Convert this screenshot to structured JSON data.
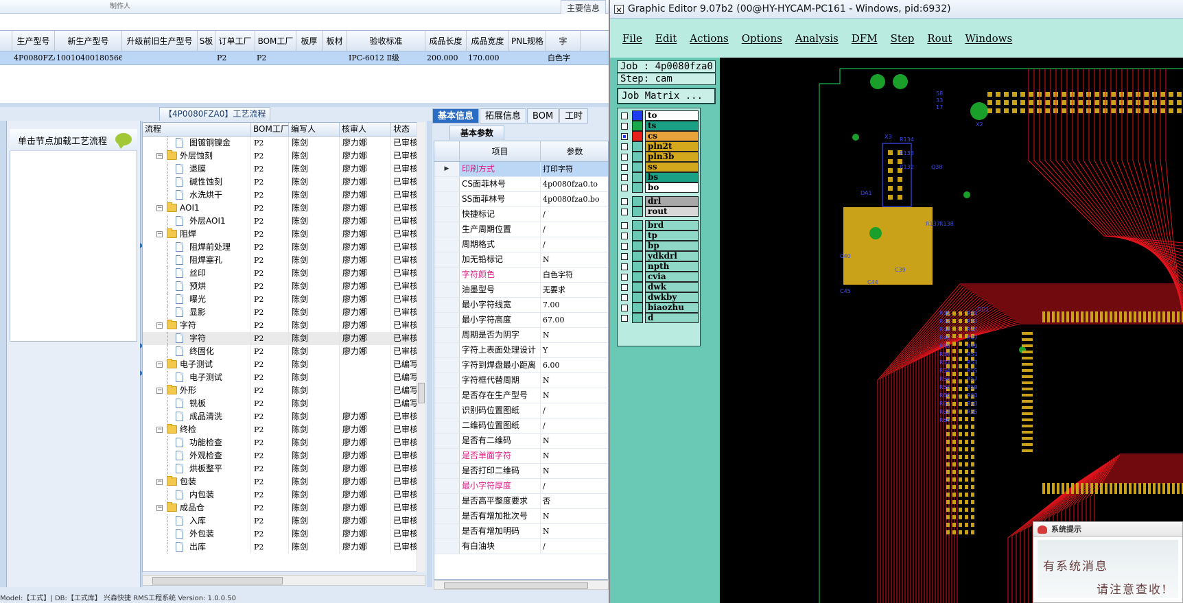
{
  "top": {
    "stub": "制作人",
    "main_info_tab": "主要信息"
  },
  "grid1": {
    "headers": [
      "",
      "生产型号",
      "新生产型号",
      "升级前旧生产型号",
      "S板",
      "订单工厂",
      "BOM工厂",
      "板厚",
      "板材",
      "验收标准",
      "成品长度",
      "成品宽度",
      "PNL规格",
      "字"
    ],
    "row": [
      "",
      "4P0080FZA0",
      "10010400180566",
      "",
      "",
      "P2",
      "P2",
      "",
      "",
      "IPC-6012 Ⅱ级",
      "200.000",
      "170.000",
      "",
      "白色字"
    ]
  },
  "process_title": "【4P0080FZA0】工艺流程",
  "node_hint": "单击节点加载工艺流程",
  "tree": {
    "headers": [
      "流程",
      "BOM工厂",
      "编写人",
      "核审人",
      "状态"
    ],
    "rows": [
      {
        "label": "图镀铜镍金",
        "level": 2,
        "kind": "doc",
        "bom": "P2",
        "writer": "陈剑",
        "reviewer": "廖力娜",
        "status": "已审核"
      },
      {
        "label": "外层蚀刻",
        "level": 1,
        "kind": "folder",
        "bom": "P2",
        "writer": "陈剑",
        "reviewer": "廖力娜",
        "status": "已审核"
      },
      {
        "label": "退膜",
        "level": 2,
        "kind": "doc",
        "bom": "P2",
        "writer": "陈剑",
        "reviewer": "廖力娜",
        "status": "已审核"
      },
      {
        "label": "碱性蚀刻",
        "level": 2,
        "kind": "doc",
        "bom": "P2",
        "writer": "陈剑",
        "reviewer": "廖力娜",
        "status": "已审核"
      },
      {
        "label": "水洗烘干",
        "level": 2,
        "kind": "doc",
        "bom": "P2",
        "writer": "陈剑",
        "reviewer": "廖力娜",
        "status": "已审核"
      },
      {
        "label": "AOI1",
        "level": 1,
        "kind": "folder",
        "bom": "P2",
        "writer": "陈剑",
        "reviewer": "廖力娜",
        "status": "已审核"
      },
      {
        "label": "外层AOI1",
        "level": 2,
        "kind": "doc",
        "bom": "P2",
        "writer": "陈剑",
        "reviewer": "廖力娜",
        "status": "已审核"
      },
      {
        "label": "阻焊",
        "level": 1,
        "kind": "folder",
        "bom": "P2",
        "writer": "陈剑",
        "reviewer": "廖力娜",
        "status": "已审核"
      },
      {
        "label": "阻焊前处理",
        "level": 2,
        "kind": "doc",
        "bom": "P2",
        "writer": "陈剑",
        "reviewer": "廖力娜",
        "status": "已审核"
      },
      {
        "label": "阻焊塞孔",
        "level": 2,
        "kind": "doc",
        "bom": "P2",
        "writer": "陈剑",
        "reviewer": "廖力娜",
        "status": "已审核"
      },
      {
        "label": "丝印",
        "level": 2,
        "kind": "doc",
        "bom": "P2",
        "writer": "陈剑",
        "reviewer": "廖力娜",
        "status": "已审核"
      },
      {
        "label": "预烘",
        "level": 2,
        "kind": "doc",
        "bom": "P2",
        "writer": "陈剑",
        "reviewer": "廖力娜",
        "status": "已审核"
      },
      {
        "label": "曝光",
        "level": 2,
        "kind": "doc",
        "bom": "P2",
        "writer": "陈剑",
        "reviewer": "廖力娜",
        "status": "已审核"
      },
      {
        "label": "显影",
        "level": 2,
        "kind": "doc",
        "bom": "P2",
        "writer": "陈剑",
        "reviewer": "廖力娜",
        "status": "已审核"
      },
      {
        "label": "字符",
        "level": 1,
        "kind": "folder",
        "bom": "P2",
        "writer": "陈剑",
        "reviewer": "廖力娜",
        "status": "已审核"
      },
      {
        "label": "字符",
        "level": 2,
        "kind": "doc",
        "bom": "P2",
        "writer": "陈剑",
        "reviewer": "廖力娜",
        "status": "已审核",
        "selected": true
      },
      {
        "label": "终固化",
        "level": 2,
        "kind": "doc",
        "bom": "P2",
        "writer": "陈剑",
        "reviewer": "廖力娜",
        "status": "已审核"
      },
      {
        "label": "电子测试",
        "level": 1,
        "kind": "folder",
        "bom": "P2",
        "writer": "陈剑",
        "reviewer": "",
        "status": "已编写"
      },
      {
        "label": "电子测试",
        "level": 2,
        "kind": "doc",
        "bom": "P2",
        "writer": "陈剑",
        "reviewer": "",
        "status": "已编写"
      },
      {
        "label": "外形",
        "level": 1,
        "kind": "folder",
        "bom": "P2",
        "writer": "陈剑",
        "reviewer": "",
        "status": "已编写"
      },
      {
        "label": "铣板",
        "level": 2,
        "kind": "doc",
        "bom": "P2",
        "writer": "陈剑",
        "reviewer": "",
        "status": "已编写"
      },
      {
        "label": "成品清洗",
        "level": 2,
        "kind": "doc",
        "bom": "P2",
        "writer": "陈剑",
        "reviewer": "廖力娜",
        "status": "已审核"
      },
      {
        "label": "终检",
        "level": 1,
        "kind": "folder",
        "bom": "P2",
        "writer": "陈剑",
        "reviewer": "廖力娜",
        "status": "已审核"
      },
      {
        "label": "功能检查",
        "level": 2,
        "kind": "doc",
        "bom": "P2",
        "writer": "陈剑",
        "reviewer": "廖力娜",
        "status": "已审核"
      },
      {
        "label": "外观检查",
        "level": 2,
        "kind": "doc",
        "bom": "P2",
        "writer": "陈剑",
        "reviewer": "廖力娜",
        "status": "已审核"
      },
      {
        "label": "烘板整平",
        "level": 2,
        "kind": "doc",
        "bom": "P2",
        "writer": "陈剑",
        "reviewer": "廖力娜",
        "status": "已审核"
      },
      {
        "label": "包装",
        "level": 1,
        "kind": "folder",
        "bom": "P2",
        "writer": "陈剑",
        "reviewer": "廖力娜",
        "status": "已审核"
      },
      {
        "label": "内包装",
        "level": 2,
        "kind": "doc",
        "bom": "P2",
        "writer": "陈剑",
        "reviewer": "廖力娜",
        "status": "已审核"
      },
      {
        "label": "成品仓",
        "level": 1,
        "kind": "folder",
        "bom": "P2",
        "writer": "陈剑",
        "reviewer": "廖力娜",
        "status": "已审核"
      },
      {
        "label": "入库",
        "level": 2,
        "kind": "doc",
        "bom": "P2",
        "writer": "陈剑",
        "reviewer": "廖力娜",
        "status": "已审核"
      },
      {
        "label": "外包装",
        "level": 2,
        "kind": "doc",
        "bom": "P2",
        "writer": "陈剑",
        "reviewer": "廖力娜",
        "status": "已审核"
      },
      {
        "label": "出库",
        "level": 2,
        "kind": "doc",
        "bom": "P2",
        "writer": "陈剑",
        "reviewer": "廖力娜",
        "status": "已审核"
      }
    ]
  },
  "detail": {
    "tabs": [
      "基本信息",
      "拓展信息",
      "BOM",
      "工时"
    ],
    "subtab": "基本参数",
    "headers": [
      "",
      "项目",
      "参数"
    ],
    "rows": [
      {
        "item": "印刷方式",
        "value": "打印字符",
        "pink": true,
        "first": true
      },
      {
        "item": "CS面菲林号",
        "value": "4p0080fza0.to"
      },
      {
        "item": "SS面菲林号",
        "value": "4p0080fza0.bo"
      },
      {
        "item": "快捷标记",
        "value": "/"
      },
      {
        "item": "生产周期位置",
        "value": "/"
      },
      {
        "item": "周期格式",
        "value": "/"
      },
      {
        "item": "加无铅标记",
        "value": "N"
      },
      {
        "item": "字符颜色",
        "value": "白色字符",
        "pink": true
      },
      {
        "item": "油墨型号",
        "value": "无要求"
      },
      {
        "item": "最小字符线宽",
        "value": "7.00"
      },
      {
        "item": "最小字符高度",
        "value": "67.00"
      },
      {
        "item": "周期是否为阴字",
        "value": "N"
      },
      {
        "item": "字符上表面处理设计",
        "value": "Y"
      },
      {
        "item": "字符到焊盘最小距离",
        "value": "6.00"
      },
      {
        "item": "字符框代替周期",
        "value": "N"
      },
      {
        "item": "是否存在生产型号",
        "value": "N"
      },
      {
        "item": "识别码位置图纸",
        "value": "/"
      },
      {
        "item": "二维码位置图纸",
        "value": "/"
      },
      {
        "item": "是否有二维码",
        "value": "N"
      },
      {
        "item": "是否单面字符",
        "value": "N",
        "pink": true
      },
      {
        "item": "是否打印二维码",
        "value": "N"
      },
      {
        "item": "最小字符厚度",
        "value": "/",
        "pink": true
      },
      {
        "item": "是否高平整度要求",
        "value": "否"
      },
      {
        "item": "是否有增加批次号",
        "value": "N"
      },
      {
        "item": "是否有增加明码",
        "value": "N"
      },
      {
        "item": "有白油块",
        "value": "/"
      }
    ]
  },
  "status_bar": "Model:【工式】| DB:【工式库】                                              兴森快捷  RMS工程系统  Version: 1.0.0.50",
  "ge": {
    "title": "Graphic Editor 9.07b2 (00@HY-HYCAM-PC161 - Windows, pid:6932)",
    "menu": [
      "File",
      "Edit",
      "Actions",
      "Options",
      "Analysis",
      "DFM",
      "Step",
      "Rout",
      "Windows"
    ],
    "job": "Job : 4p0080fza0",
    "step": "Step: cam",
    "job_matrix": "Job Matrix ...",
    "layers": [
      {
        "name": "to",
        "color": "#1d3cf0",
        "bg": "#ffffff"
      },
      {
        "name": "ts",
        "color": "#1aa84a",
        "bg": "#1aa084"
      },
      {
        "name": "cs",
        "color": "#e8201c",
        "bg": "#e8a33a",
        "active": true
      },
      {
        "name": "pln2t",
        "color": "",
        "bg": "#d4a81c"
      },
      {
        "name": "pln3b",
        "color": "",
        "bg": "#d4a81c"
      },
      {
        "name": "ss",
        "color": "",
        "bg": "#d4a81c"
      },
      {
        "name": "bs",
        "color": "",
        "bg": "#1aa084"
      },
      {
        "name": "bo",
        "color": "",
        "bg": "#ffffff"
      },
      {
        "name": "drl",
        "color": "",
        "bg": "#a8a8a8"
      },
      {
        "name": "rout",
        "color": "",
        "bg": "#d8d8d8"
      },
      {
        "name": "brd",
        "color": "",
        "bg": "#8fd8c8"
      },
      {
        "name": "tp",
        "color": "",
        "bg": "#8fd8c8"
      },
      {
        "name": "bp",
        "color": "",
        "bg": "#8fd8c8"
      },
      {
        "name": "ydkdrl",
        "color": "",
        "bg": "#8fd8c8"
      },
      {
        "name": "npth",
        "color": "",
        "bg": "#8fd8c8"
      },
      {
        "name": "cvia",
        "color": "",
        "bg": "#8fd8c8"
      },
      {
        "name": "dwk",
        "color": "",
        "bg": "#8fd8c8"
      },
      {
        "name": "dwkby",
        "color": "",
        "bg": "#8fd8c8"
      },
      {
        "name": "biaozhu",
        "color": "",
        "bg": "#8fd8c8"
      },
      {
        "name": "d",
        "color": "",
        "bg": "#8fd8c8"
      }
    ],
    "pcb_labels": [
      "X3",
      "DA1",
      "X2",
      "R134",
      "R133",
      "R132",
      "Q38",
      "R137",
      "R138",
      "C40",
      "C45",
      "C44",
      "C39",
      "DD1",
      "R39",
      "R41",
      "R42",
      "R43",
      "R44",
      "R45",
      "R46",
      "R47",
      "R48",
      "R49",
      "R50",
      "R51",
      "R52",
      "R53",
      "R54",
      "R55",
      "R56",
      "R57",
      "R58",
      "R59",
      "R60",
      "R61",
      "R62",
      "R63",
      "R64",
      "R65",
      "R66",
      "58",
      "33",
      "17"
    ]
  },
  "popup": {
    "title": "系统提示",
    "line1": "有系统消息",
    "line2": "请注意查收!"
  }
}
